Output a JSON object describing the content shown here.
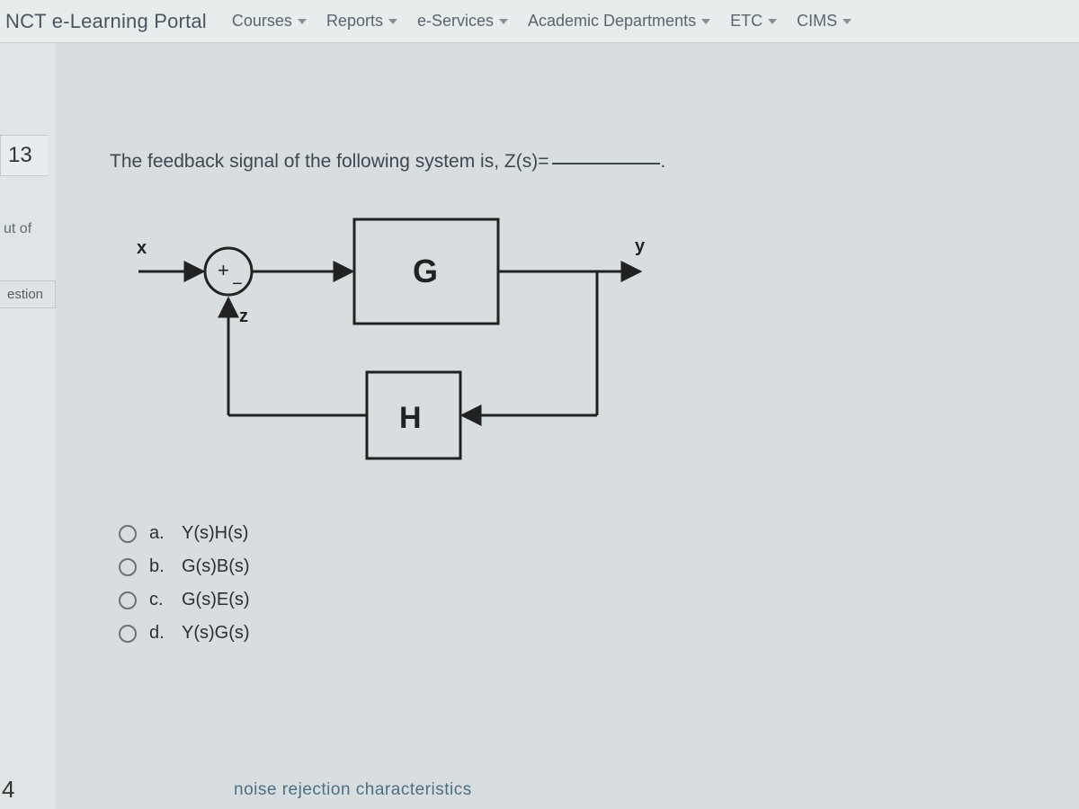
{
  "nav": {
    "brand": "NCT e-Learning Portal",
    "items": [
      "Courses",
      "Reports",
      "e-Services",
      "Academic Departments",
      "ETC",
      "CIMS"
    ]
  },
  "sidebar": {
    "question_number": "13",
    "out_of_label": "ut of",
    "flag_label": "estion",
    "bottom_number": "4"
  },
  "question": {
    "prompt_pre": "The feedback signal of the following system is, Z(s)=",
    "diagram": {
      "input_label": "x",
      "output_label": "y",
      "sum_plus": "+",
      "sum_minus": "−",
      "feedback_label": "z",
      "block_forward": "G",
      "block_feedback": "H"
    },
    "options": [
      {
        "letter": "a.",
        "text": "Y(s)H(s)"
      },
      {
        "letter": "b.",
        "text": "G(s)B(s)"
      },
      {
        "letter": "c.",
        "text": "G(s)E(s)"
      },
      {
        "letter": "d.",
        "text": "Y(s)G(s)"
      }
    ]
  },
  "bottom_fragment": "noise rejection characteristics"
}
